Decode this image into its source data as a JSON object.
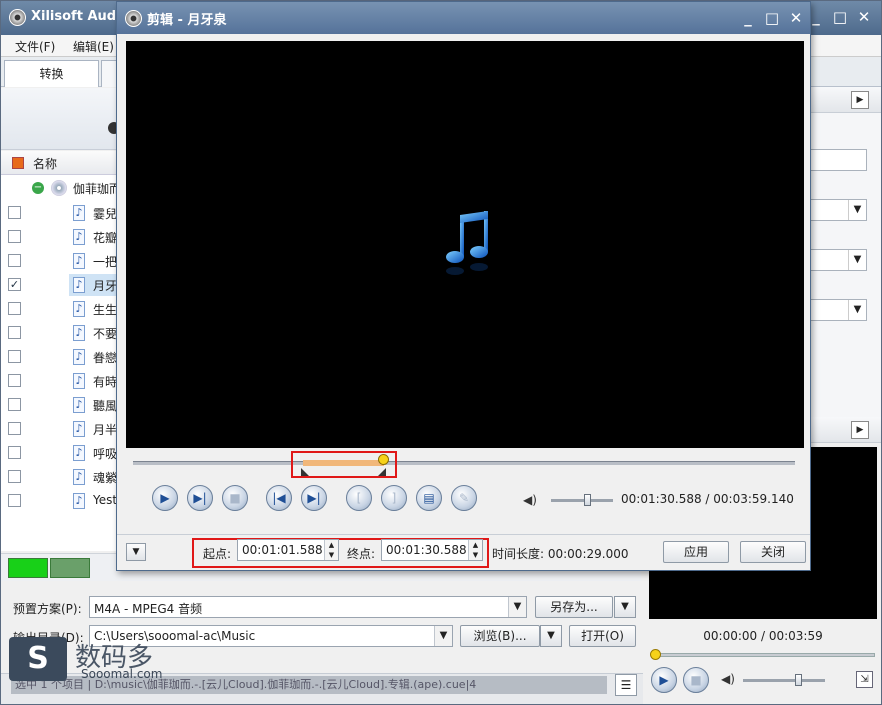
{
  "main": {
    "title": "Xilisoft Audio",
    "menu": [
      "文件(F)",
      "编辑(E)"
    ],
    "tab_convert": "转换",
    "list_header": "名称",
    "album": "伽菲珈而",
    "tracks": [
      {
        "name": "霎兒",
        "checked": false,
        "selected": false
      },
      {
        "name": "花瓣",
        "checked": false,
        "selected": false
      },
      {
        "name": "一把",
        "checked": false,
        "selected": false
      },
      {
        "name": "月牙",
        "checked": true,
        "selected": true
      },
      {
        "name": "生生",
        "checked": false,
        "selected": false
      },
      {
        "name": "不要",
        "checked": false,
        "selected": false
      },
      {
        "name": "眷戀",
        "checked": false,
        "selected": false
      },
      {
        "name": "有時",
        "checked": false,
        "selected": false
      },
      {
        "name": "聽風",
        "checked": false,
        "selected": false
      },
      {
        "name": "月半",
        "checked": false,
        "selected": false
      },
      {
        "name": "呼吸",
        "checked": false,
        "selected": false
      },
      {
        "name": "魂縈",
        "checked": false,
        "selected": false
      },
      {
        "name": "Yeste",
        "checked": false,
        "selected": false
      }
    ],
    "profile_label": "预置方案(P):",
    "profile_value": "M4A - MPEG4 音频",
    "save_as": "另存为...",
    "output_label": "输出目录(D):",
    "output_value": "C:\\Users\\sooomal-ac\\Music",
    "browse": "浏览(B)...",
    "open": "打开(O)",
    "status": "选中 1 个项目 | D:\\music\\伽菲珈而.-.[云儿Cloud].伽菲珈而.-.[云儿Cloud].专辑.(ape).cue|4",
    "preview_time": "00:00:00 / 00:03:59",
    "watermark_cn": "数码多",
    "watermark_en": "Sooomal.com"
  },
  "dialog": {
    "title": "剪辑 - 月牙泉",
    "time_display": "00:01:30.588 / 00:03:59.140",
    "start_label": "起点:",
    "start_value": "00:01:01.588",
    "end_label": "终点:",
    "end_value": "00:01:30.588",
    "duration": "时间长度: 00:00:29.000",
    "apply": "应用",
    "close": "关闭",
    "total_seconds": 239.14,
    "start_seconds": 61.588,
    "end_seconds": 90.588,
    "position_seconds": 90.588,
    "volume_level": 0.6
  },
  "icons": [
    "app-logo-icon",
    "minimize-icon",
    "maximize-icon",
    "close-icon",
    "play-icon",
    "play-selection-icon",
    "stop-icon",
    "prev-icon",
    "next-icon",
    "mark-in-icon",
    "mark-out-icon",
    "snapshot-icon",
    "edit-icon",
    "volume-icon",
    "music-note-icon"
  ],
  "colors": {
    "title_bar": "#55729a",
    "selection": "#f1b77a",
    "highlight": "#e01818",
    "knob": "#f6d21a"
  }
}
